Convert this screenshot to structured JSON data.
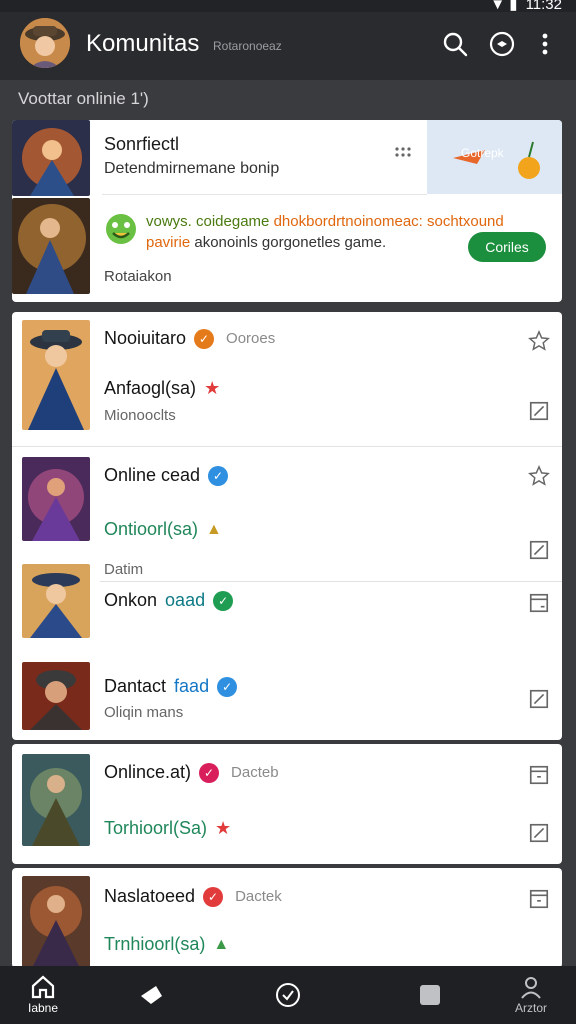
{
  "status": {
    "time": "11:32"
  },
  "app": {
    "title": "Komunitas",
    "subtitle": "Rotaronoeaz"
  },
  "section": {
    "header": "Voottar onlinie 1')"
  },
  "featured": {
    "title": "Sonrfiectl",
    "subtitle": "Detendmirnemane bonip",
    "banner_label": "Gotrepk",
    "promo_line1_a": "vowys. coidegame",
    "promo_line1_b": " dhokbordrtnoinomeac: sochtxound",
    "promo_line2_a": "pavirie",
    "promo_line2_b": " akonoinls gorgonetles game.",
    "button": "Coriles",
    "footer": "Rotaiakon"
  },
  "rows": [
    {
      "name": "Nooiuitaro",
      "tag": "Ooroes",
      "sub": "Anfaogl(sa)",
      "meta": "Mionooclts",
      "badge_color": "#e47a1a",
      "sub_badge_color": "#e23b3b"
    },
    {
      "name": "Online cead",
      "tag": "",
      "sub": "Ontioorl(sa)",
      "meta": "Datim",
      "badge_color": "#2f8fe0",
      "sub_badge_color": "#c79a24"
    },
    {
      "name_a": "Onkon ",
      "name_b": "oaad",
      "badge_color": "#1f9d52"
    },
    {
      "name_a": "Dantact ",
      "name_b": "faad",
      "meta": "Oliqin mans",
      "badge_color": "#2f8fe0"
    },
    {
      "name": "Onlince.at)",
      "tag": "Dacteb",
      "sub": "Torhioorl(Sa)",
      "badge_color": "#d81f5c",
      "sub_badge_color": "#e23b3b"
    },
    {
      "name": "Naslatoeed",
      "tag": "Dactek",
      "sub": "Trnhioorl(sa)",
      "badge_color": "#e23b3b",
      "sub_badge_color": "#3a9a47"
    }
  ],
  "nav": [
    {
      "label": "Iabne"
    },
    {
      "label": ""
    },
    {
      "label": ""
    },
    {
      "label": ""
    },
    {
      "label": "Arztor"
    }
  ]
}
